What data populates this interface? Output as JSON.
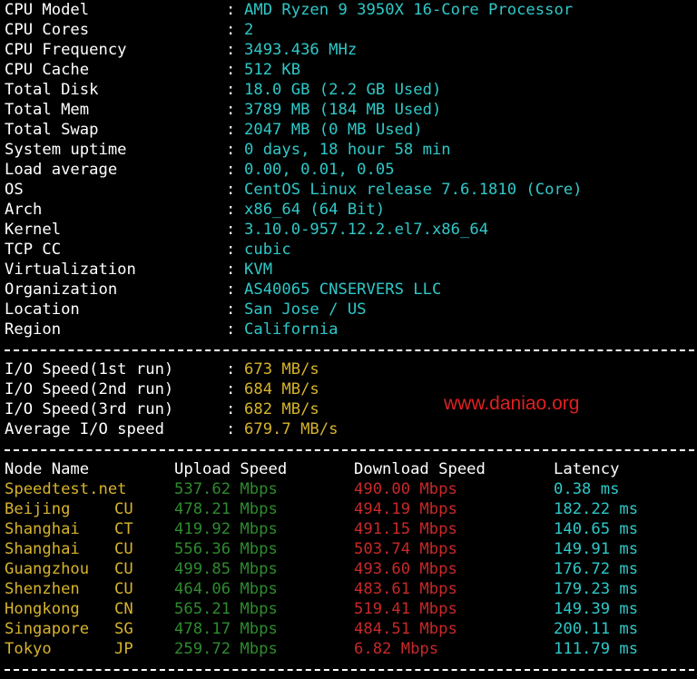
{
  "system_info": [
    {
      "label": "CPU Model",
      "value": "AMD Ryzen 9 3950X 16-Core Processor"
    },
    {
      "label": "CPU Cores",
      "value": "2"
    },
    {
      "label": "CPU Frequency",
      "value": "3493.436 MHz"
    },
    {
      "label": "CPU Cache",
      "value": "512 KB"
    },
    {
      "label": "Total Disk",
      "value": "18.0 GB (2.2 GB Used)"
    },
    {
      "label": "Total Mem",
      "value": "3789 MB (184 MB Used)"
    },
    {
      "label": "Total Swap",
      "value": "2047 MB (0 MB Used)"
    },
    {
      "label": "System uptime",
      "value": "0 days, 18 hour 58 min"
    },
    {
      "label": "Load average",
      "value": "0.00, 0.01, 0.05"
    },
    {
      "label": "OS",
      "value": "CentOS Linux release 7.6.1810 (Core)"
    },
    {
      "label": "Arch",
      "value": "x86_64 (64 Bit)"
    },
    {
      "label": "Kernel",
      "value": "3.10.0-957.12.2.el7.x86_64"
    },
    {
      "label": "TCP CC",
      "value": "cubic"
    },
    {
      "label": "Virtualization",
      "value": "KVM"
    },
    {
      "label": "Organization",
      "value": "AS40065 CNSERVERS LLC"
    },
    {
      "label": "Location",
      "value": "San Jose / US"
    },
    {
      "label": "Region",
      "value": "California"
    }
  ],
  "io_speed": [
    {
      "label": "I/O Speed(1st run)",
      "value": "673 MB/s"
    },
    {
      "label": "I/O Speed(2nd run)",
      "value": "684 MB/s"
    },
    {
      "label": "I/O Speed(3rd run)",
      "value": "682 MB/s"
    },
    {
      "label": "Average I/O speed",
      "value": "679.7 MB/s"
    }
  ],
  "colon": ":",
  "watermark": "www.daniao.org",
  "speed_table": {
    "headers": {
      "node": "Node Name",
      "upload": "Upload Speed",
      "download": "Download Speed",
      "latency": "Latency"
    },
    "rows": [
      {
        "node": "Speedtest.net",
        "isp": "",
        "upload": "537.62 Mbps",
        "download": "490.00 Mbps",
        "latency": "0.38 ms"
      },
      {
        "node": "Beijing",
        "isp": "CU",
        "upload": "478.21 Mbps",
        "download": "494.19 Mbps",
        "latency": "182.22 ms"
      },
      {
        "node": "Shanghai",
        "isp": "CT",
        "upload": "419.92 Mbps",
        "download": "491.15 Mbps",
        "latency": "140.65 ms"
      },
      {
        "node": "Shanghai",
        "isp": "CU",
        "upload": "556.36 Mbps",
        "download": "503.74 Mbps",
        "latency": "149.91 ms"
      },
      {
        "node": "Guangzhou",
        "isp": "CU",
        "upload": "499.85 Mbps",
        "download": "493.60 Mbps",
        "latency": "176.72 ms"
      },
      {
        "node": "Shenzhen",
        "isp": "CU",
        "upload": "464.06 Mbps",
        "download": "483.61 Mbps",
        "latency": "179.23 ms"
      },
      {
        "node": "Hongkong",
        "isp": "CN",
        "upload": "565.21 Mbps",
        "download": "519.41 Mbps",
        "latency": "149.39 ms"
      },
      {
        "node": "Singapore",
        "isp": "SG",
        "upload": "478.17 Mbps",
        "download": "484.51 Mbps",
        "latency": "200.11 ms"
      },
      {
        "node": "Tokyo",
        "isp": "JP",
        "upload": "259.72 Mbps",
        "download": "6.82 Mbps",
        "latency": "111.79 ms"
      }
    ]
  },
  "colors": {
    "label": "#ffffff",
    "value": "#2fc8c8",
    "io_value": "#d7b32c",
    "node": "#d7b32c",
    "upload": "#2f8a2f",
    "download": "#c82828",
    "latency": "#2fc8c8",
    "watermark": "#e02020"
  }
}
